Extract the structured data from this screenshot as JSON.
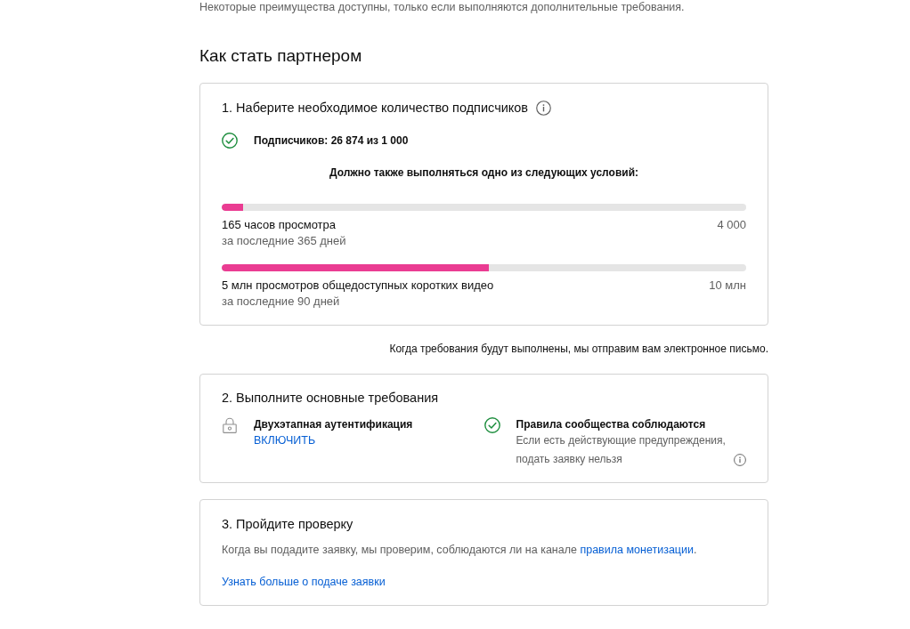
{
  "intro": "Некоторые преимущества доступны, только если выполняются дополнительные требования.",
  "heading": "Как стать партнером",
  "subscribers_card": {
    "title": "1. Наберите необходимое количество подписчиков",
    "subscriber_status": {
      "text": "Подписчиков: 26 874 из 1 000",
      "met": true
    },
    "condition_note": "Должно также выполняться одно из следующих условий:",
    "metrics": [
      {
        "label": "165 часов просмотра",
        "period": "за последние 365 дней",
        "target": "4 000",
        "level": 0.041
      },
      {
        "label": "5 млн просмотров общедоступных коротких видео",
        "period": "за последние 90 дней",
        "target": "10 млн",
        "level": 0.51
      }
    ]
  },
  "email_note": "Когда требования будут выполнены, мы отправим вам электронное письмо.",
  "requirements_card": {
    "title": "2. Выполните основные требования",
    "items": [
      {
        "title": "Двухэтапная аутентификация",
        "met": false,
        "link": "ВКЛЮЧИТЬ"
      },
      {
        "title": "Правила сообщества соблюдаются",
        "met": true,
        "description": "Если есть действующие предупреждения, подать заявку нельзя"
      }
    ]
  },
  "review_card": {
    "title": "3. Пройдите проверку",
    "text_before": "Когда вы подадите заявку, мы проверим, соблюдаются ли на канале ",
    "link": "правила монетизации",
    "text_after": ".",
    "learn_more": "Узнать больше о подаче заявки"
  }
}
